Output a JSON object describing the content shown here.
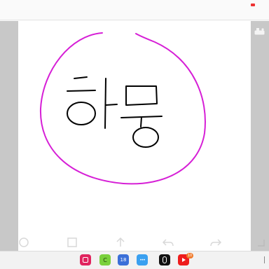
{
  "canvas": {
    "ink_color": "#d61fd6",
    "text_color": "#000000"
  },
  "toolbar": {
    "items": [
      {
        "icon": "circle-outline-icon"
      },
      {
        "icon": "square-outline-icon"
      },
      {
        "icon": "share-up-icon"
      },
      {
        "icon": "undo-icon"
      },
      {
        "icon": "redo-icon"
      }
    ]
  },
  "dock": {
    "apps": [
      {
        "icon": "app-red-icon",
        "color": "#e0245e"
      },
      {
        "icon": "app-green-c-icon",
        "color": "#7ad13c",
        "glyph": "C"
      },
      {
        "icon": "calendar-icon",
        "color": "#3b6fd8",
        "glyph": "18"
      },
      {
        "icon": "messages-icon",
        "color": "#3aa0f0",
        "glyph": "•••"
      },
      {
        "icon": "app-black-icon",
        "color": "#111111"
      },
      {
        "icon": "youtube-icon",
        "color": "#ee1c1c",
        "badge": "10"
      }
    ]
  }
}
